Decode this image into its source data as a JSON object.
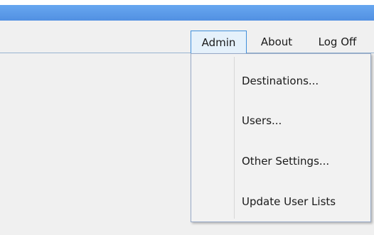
{
  "menubar": {
    "items": [
      {
        "label": "Admin",
        "active": true
      },
      {
        "label": "About",
        "active": false
      },
      {
        "label": "Log Off",
        "active": false
      }
    ]
  },
  "admin_menu": {
    "items": [
      {
        "label": "Destinations..."
      },
      {
        "label": "Users..."
      },
      {
        "label": "Other Settings..."
      },
      {
        "label": "Update User Lists"
      }
    ]
  },
  "colors": {
    "title_strip": "#5a9ae8",
    "menubar_bg": "#f0f0f0",
    "active_menu_bg": "#e5f1fb",
    "active_menu_border": "#3f8fdc",
    "dropdown_bg": "#f2f2f2"
  }
}
